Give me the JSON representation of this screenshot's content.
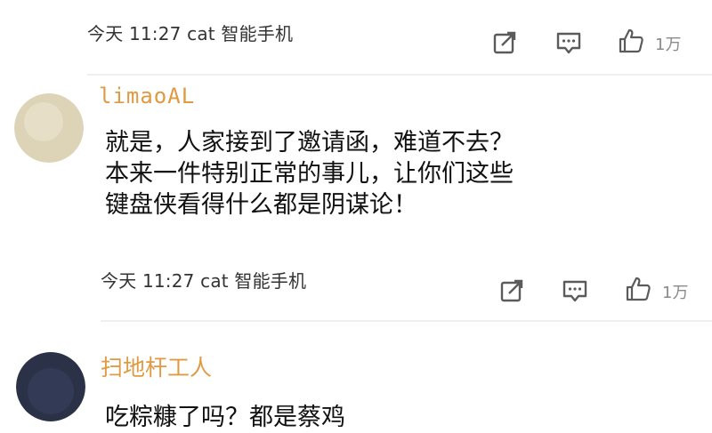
{
  "comments": [
    {
      "meta": "今天 11:27 cat 智能手机",
      "likes": "1万"
    },
    {
      "username": "limaoAL",
      "text_lines": [
        "就是，人家接到了邀请函，难道不去？",
        "本来一件特别正常的事儿，让你们这些",
        "键盘侠看得什么都是阴谋论！"
      ],
      "meta": "今天 11:27 cat 智能手机",
      "likes": "1万"
    },
    {
      "username": "扫地杆工人",
      "text_lines": [
        "吃粽糠了吗？都是蔡鸡"
      ]
    }
  ],
  "colors": {
    "username": "#e09a43",
    "icon": "#5b5b5b",
    "divider": "#efefef",
    "avatar_1": "#ddd3b6",
    "avatar_2": "#2b3147"
  },
  "icons": [
    "share-icon",
    "reply-icon",
    "thumbs-up-icon"
  ]
}
